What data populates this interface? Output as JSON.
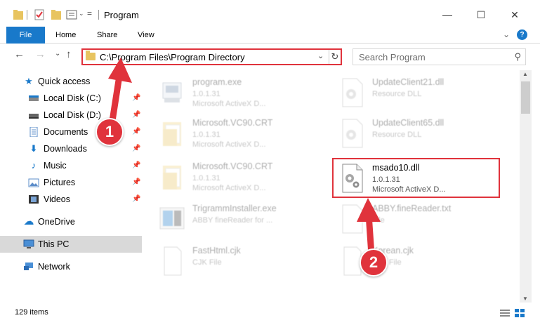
{
  "window": {
    "title": "Program",
    "minimize": "—",
    "maximize": "☐",
    "close": "✕"
  },
  "ribbon": {
    "tabs": [
      "File",
      "Home",
      "Share",
      "View"
    ],
    "expand": "⌄",
    "help": "?"
  },
  "nav": {
    "back": "←",
    "forward": "→",
    "recent": "⌄",
    "up": "↑",
    "address": "C:\\Program Files\\Program Directory",
    "search_placeholder": "Search Program"
  },
  "sidebar": {
    "items": [
      {
        "label": "Quick access",
        "icon": "star-icon",
        "pinned": false
      },
      {
        "label": "Local Disk (C:)",
        "icon": "drive-icon",
        "pinned": true
      },
      {
        "label": "Local Disk (D:)",
        "icon": "drive-icon",
        "pinned": true
      },
      {
        "label": "Documents",
        "icon": "documents-icon",
        "pinned": true
      },
      {
        "label": "Downloads",
        "icon": "download-icon",
        "pinned": true
      },
      {
        "label": "Music",
        "icon": "music-icon",
        "pinned": true
      },
      {
        "label": "Pictures",
        "icon": "pictures-icon",
        "pinned": true
      },
      {
        "label": "Videos",
        "icon": "videos-icon",
        "pinned": true
      },
      {
        "label": "OneDrive",
        "icon": "cloud-icon",
        "pinned": false
      },
      {
        "label": "This PC",
        "icon": "computer-icon",
        "pinned": false
      },
      {
        "label": "Network",
        "icon": "network-icon",
        "pinned": false
      }
    ]
  },
  "files": [
    {
      "name": "program.exe",
      "line1": "1.0.1.31",
      "line2": "Microsoft ActiveX D...",
      "icon": "exe-icon"
    },
    {
      "name": "UpdateClient21.dll",
      "line1": "Resource DLL",
      "line2": "",
      "icon": "dll-icon"
    },
    {
      "name": "Microsoft.VC90.CRT",
      "line1": "1.0.1.31",
      "line2": "Microsoft ActiveX D...",
      "icon": "folder-icon"
    },
    {
      "name": "UpdateClient65.dll",
      "line1": "Resource DLL",
      "line2": "",
      "icon": "dll-icon"
    },
    {
      "name": "Microsoft.VC90.CRT",
      "line1": "1.0.1.31",
      "line2": "Microsoft ActiveX D...",
      "icon": "folder-icon"
    },
    {
      "name": "msado10.dll",
      "line1": "1.0.1.31",
      "line2": "Microsoft ActiveX D...",
      "icon": "dll-icon"
    },
    {
      "name": "TrigrammInstaller.exe",
      "line1": "ABBY fineReader for ...",
      "line2": "",
      "icon": "installer-icon"
    },
    {
      "name": "ABBY.fineReader.txt",
      "line1": "File",
      "line2": "",
      "icon": "text-icon"
    },
    {
      "name": "FastHtml.cjk",
      "line1": "CJK File",
      "line2": "",
      "icon": "blank-file-icon"
    },
    {
      "name": "Korean.cjk",
      "line1": "CJK File",
      "line2": "",
      "icon": "blank-file-icon"
    }
  ],
  "status": {
    "item_count": "129 items"
  },
  "annotations": {
    "badge1": "1",
    "badge2": "2"
  },
  "colors": {
    "accent": "#1979ca",
    "annotation": "#e0333c",
    "selected": "#d9d9d9"
  }
}
